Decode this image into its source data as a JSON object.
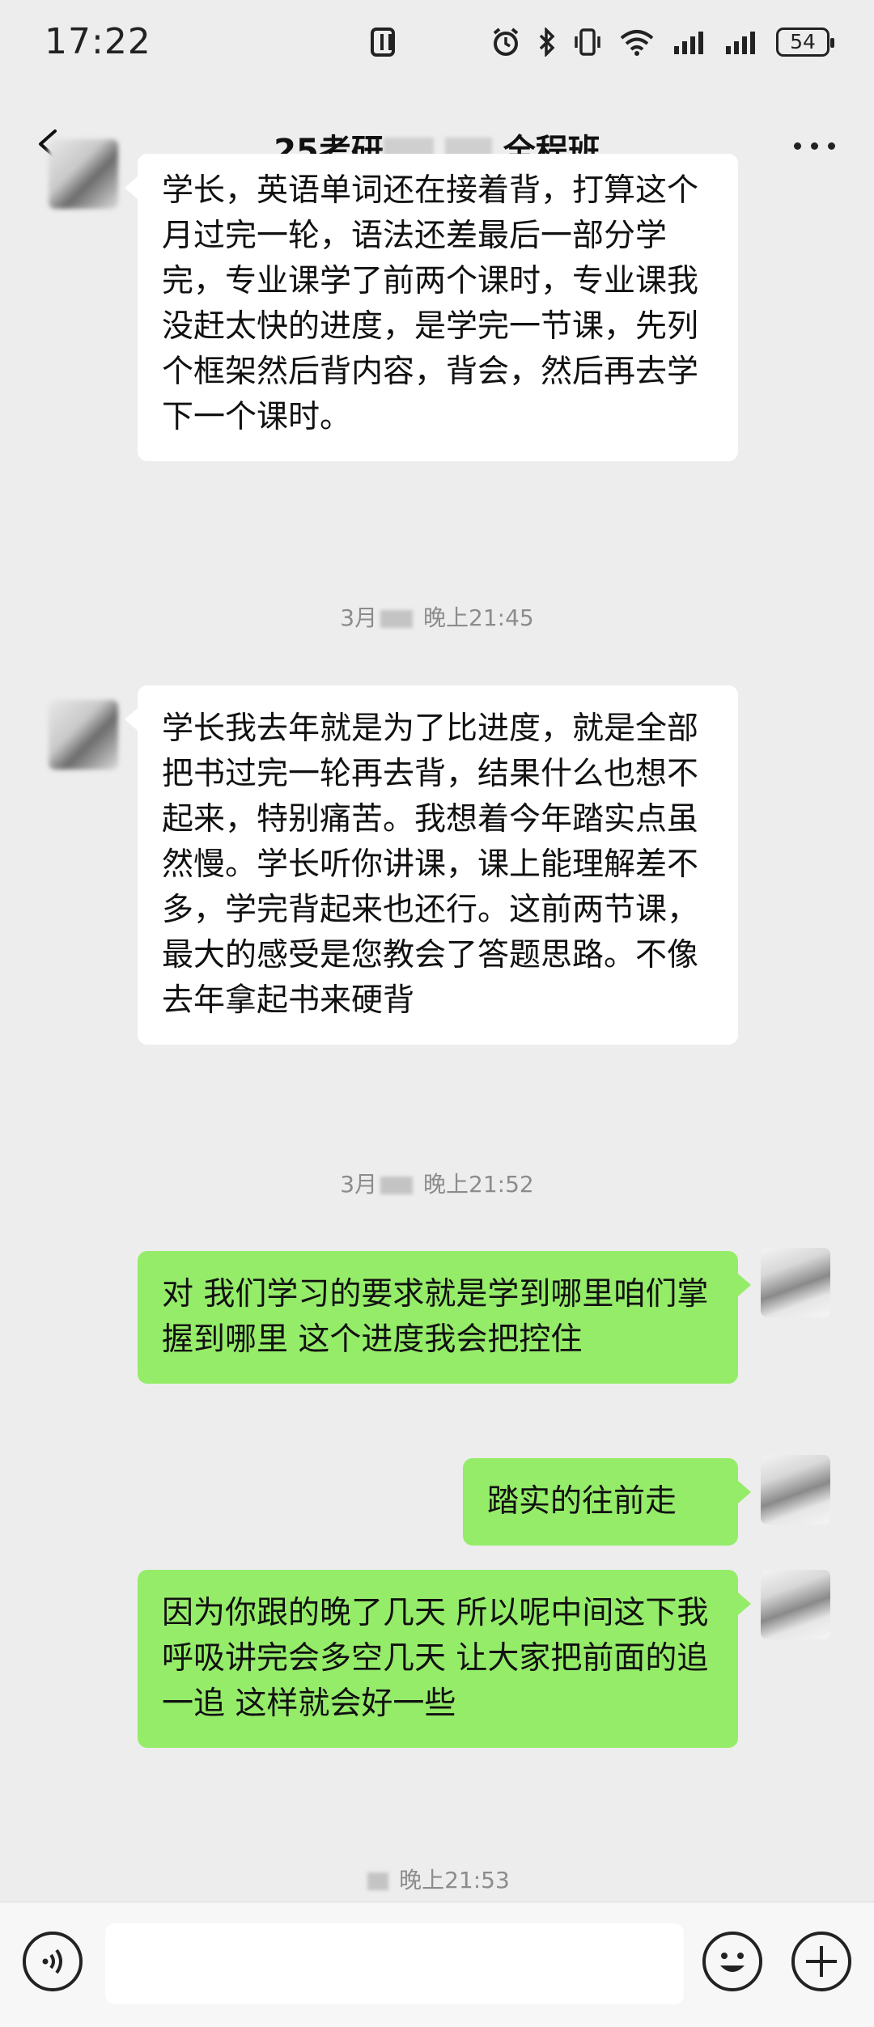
{
  "status_bar": {
    "time": "17:22",
    "battery": "54",
    "icons": [
      "nfc-icon",
      "alarm-icon",
      "bluetooth-icon",
      "vibrate-icon",
      "wifi-icon",
      "signal-icon",
      "signal-icon",
      "battery-icon"
    ]
  },
  "header": {
    "title_prefix": "25考研",
    "title_suffix": "全程班"
  },
  "messages": [
    {
      "side": "left",
      "text": "学长，英语单词还在接着背，打算这个月过完一轮，语法还差最后一部分学完，专业课学了前两个课时，专业课我没赶太快的进度，是学完一节课，先列个框架然后背内容，背会，然后再去学下一个课时。"
    },
    {
      "side": "left",
      "text": "学长我去年就是为了比进度，就是全部把书过完一轮再去背，结果什么也想不起来，特别痛苦。我想着今年踏实点虽然慢。学长听你讲课，课上能理解差不多，学完背起来也还行。这前两节课，最大的感受是您教会了答题思路。不像去年拿起书来硬背"
    },
    {
      "side": "right",
      "text": "对 我们学习的要求就是学到哪里咱们掌握到哪里 这个进度我会把控住"
    },
    {
      "side": "right",
      "text": "踏实的往前走"
    },
    {
      "side": "right",
      "text": "因为你跟的晚了几天 所以呢中间这下我呼吸讲完会多空几天 让大家把前面的追一追 这样就会好一些"
    }
  ],
  "timestamps": [
    {
      "prefix": "3月",
      "time": "晚上21:45"
    },
    {
      "prefix": "3月",
      "time": "晚上21:52"
    },
    {
      "prefix": "",
      "time": "晚上21:53"
    }
  ],
  "colors": {
    "background": "#ededed",
    "bubble_self": "#95ec69",
    "bubble_other": "#ffffff"
  }
}
